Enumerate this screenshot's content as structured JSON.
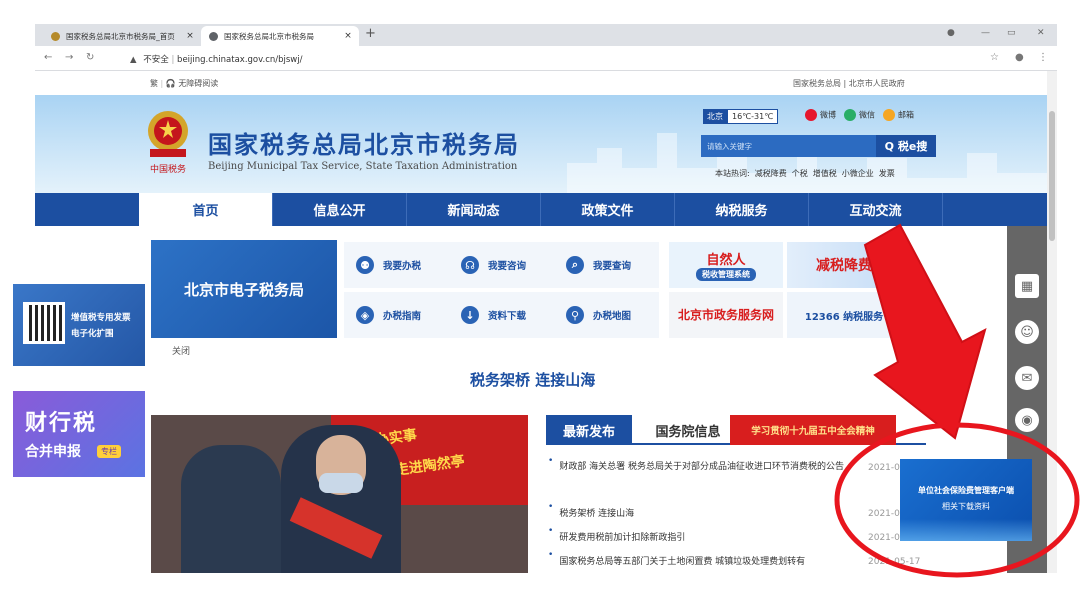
{
  "browser": {
    "tabs": [
      {
        "title": "国家税务总局北京市税务局_首页",
        "active": false
      },
      {
        "title": "国家税务总局北京市税务局",
        "active": true
      }
    ],
    "new_tab": "+",
    "url_warning": "不安全",
    "url": "beijing.chinatax.gov.cn/bjswj/"
  },
  "topbar": {
    "lang": "繁",
    "accessibility": "无障碍阅读",
    "links": "国家税务总局 | 北京市人民政府"
  },
  "header": {
    "title": "国家税务总局北京市税务局",
    "subtitle": "Beijing Municipal Tax Service, State Taxation Administration",
    "logo_text": "中国税务",
    "city": "北京",
    "temperature": "16℃-31℃",
    "social": [
      "微博",
      "微信",
      "邮箱"
    ],
    "search_placeholder": "请输入关键字",
    "search_button": "Q 税e搜",
    "hot_label": "本站热词:",
    "hot_words": [
      "减税降费",
      "个税",
      "增值税",
      "小微企业",
      "发票"
    ]
  },
  "nav": [
    "首页",
    "信息公开",
    "新闻动态",
    "政策文件",
    "纳税服务",
    "互动交流"
  ],
  "etax_title": "北京市电子税务局",
  "quick_buttons": [
    "我要办税",
    "我要咨询",
    "我要查询",
    "办税指南",
    "资料下载",
    "办税地图"
  ],
  "promos": {
    "natural_person": "自然人",
    "natural_person_sub": "税收管理系统",
    "tax_cut": "减税降费",
    "gov_service": "北京市政务服务网",
    "hotline": "12366 纳税服务"
  },
  "close_label": "关闭",
  "slogan": "税务架桥 连接山海",
  "photo_text": {
    "line1": "惠民办实事",
    "line2": "税收宣传走进陶然亭"
  },
  "news_tabs": [
    "最新发布",
    "国务院信息",
    "学习贯彻十九届五中全会精神"
  ],
  "news": [
    {
      "title": "财政部 海关总署 税务总局关于对部分成品油征收进口环节消费税的公告",
      "date": "2021-0"
    },
    {
      "title": "税务架桥 连接山海",
      "date": "2021-0"
    },
    {
      "title": "研发费用税前加计扣除新政指引",
      "date": "2021-0"
    },
    {
      "title": "国家税务总局等五部门关于土地闲置费 城镇垃圾处理费划转有",
      "date": "2021-05-17"
    }
  ],
  "left_float_1": {
    "line1": "增值税专用发票",
    "line2": "电子化扩围"
  },
  "left_float_2": {
    "big": "财行税",
    "small": "合并申报",
    "tag": "专栏"
  },
  "right_ad": {
    "line1": "单位社会保险费管理客户端",
    "line2": "相关下载资料"
  },
  "colors": {
    "brand_blue": "#1c4fa1",
    "arrow_red": "#e8161e"
  }
}
